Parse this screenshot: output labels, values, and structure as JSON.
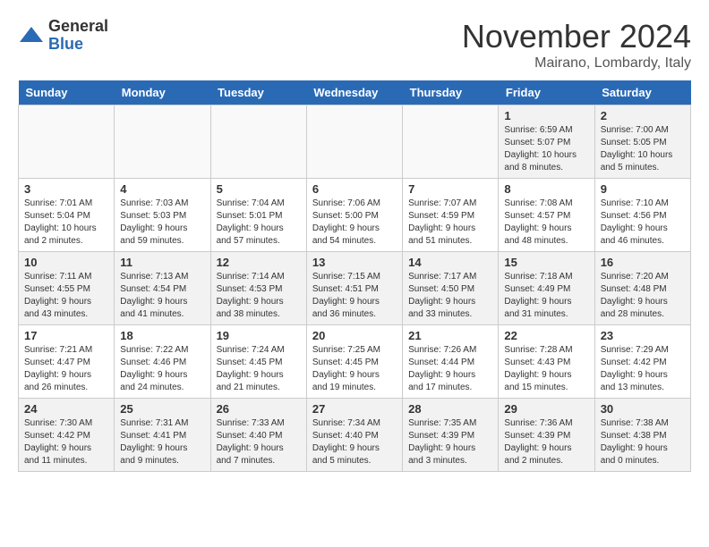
{
  "logo": {
    "general": "General",
    "blue": "Blue"
  },
  "title": "November 2024",
  "location": "Mairano, Lombardy, Italy",
  "headers": [
    "Sunday",
    "Monday",
    "Tuesday",
    "Wednesday",
    "Thursday",
    "Friday",
    "Saturday"
  ],
  "weeks": [
    [
      {
        "day": "",
        "info": ""
      },
      {
        "day": "",
        "info": ""
      },
      {
        "day": "",
        "info": ""
      },
      {
        "day": "",
        "info": ""
      },
      {
        "day": "",
        "info": ""
      },
      {
        "day": "1",
        "info": "Sunrise: 6:59 AM\nSunset: 5:07 PM\nDaylight: 10 hours and 8 minutes."
      },
      {
        "day": "2",
        "info": "Sunrise: 7:00 AM\nSunset: 5:05 PM\nDaylight: 10 hours and 5 minutes."
      }
    ],
    [
      {
        "day": "3",
        "info": "Sunrise: 7:01 AM\nSunset: 5:04 PM\nDaylight: 10 hours and 2 minutes."
      },
      {
        "day": "4",
        "info": "Sunrise: 7:03 AM\nSunset: 5:03 PM\nDaylight: 9 hours and 59 minutes."
      },
      {
        "day": "5",
        "info": "Sunrise: 7:04 AM\nSunset: 5:01 PM\nDaylight: 9 hours and 57 minutes."
      },
      {
        "day": "6",
        "info": "Sunrise: 7:06 AM\nSunset: 5:00 PM\nDaylight: 9 hours and 54 minutes."
      },
      {
        "day": "7",
        "info": "Sunrise: 7:07 AM\nSunset: 4:59 PM\nDaylight: 9 hours and 51 minutes."
      },
      {
        "day": "8",
        "info": "Sunrise: 7:08 AM\nSunset: 4:57 PM\nDaylight: 9 hours and 48 minutes."
      },
      {
        "day": "9",
        "info": "Sunrise: 7:10 AM\nSunset: 4:56 PM\nDaylight: 9 hours and 46 minutes."
      }
    ],
    [
      {
        "day": "10",
        "info": "Sunrise: 7:11 AM\nSunset: 4:55 PM\nDaylight: 9 hours and 43 minutes."
      },
      {
        "day": "11",
        "info": "Sunrise: 7:13 AM\nSunset: 4:54 PM\nDaylight: 9 hours and 41 minutes."
      },
      {
        "day": "12",
        "info": "Sunrise: 7:14 AM\nSunset: 4:53 PM\nDaylight: 9 hours and 38 minutes."
      },
      {
        "day": "13",
        "info": "Sunrise: 7:15 AM\nSunset: 4:51 PM\nDaylight: 9 hours and 36 minutes."
      },
      {
        "day": "14",
        "info": "Sunrise: 7:17 AM\nSunset: 4:50 PM\nDaylight: 9 hours and 33 minutes."
      },
      {
        "day": "15",
        "info": "Sunrise: 7:18 AM\nSunset: 4:49 PM\nDaylight: 9 hours and 31 minutes."
      },
      {
        "day": "16",
        "info": "Sunrise: 7:20 AM\nSunset: 4:48 PM\nDaylight: 9 hours and 28 minutes."
      }
    ],
    [
      {
        "day": "17",
        "info": "Sunrise: 7:21 AM\nSunset: 4:47 PM\nDaylight: 9 hours and 26 minutes."
      },
      {
        "day": "18",
        "info": "Sunrise: 7:22 AM\nSunset: 4:46 PM\nDaylight: 9 hours and 24 minutes."
      },
      {
        "day": "19",
        "info": "Sunrise: 7:24 AM\nSunset: 4:45 PM\nDaylight: 9 hours and 21 minutes."
      },
      {
        "day": "20",
        "info": "Sunrise: 7:25 AM\nSunset: 4:45 PM\nDaylight: 9 hours and 19 minutes."
      },
      {
        "day": "21",
        "info": "Sunrise: 7:26 AM\nSunset: 4:44 PM\nDaylight: 9 hours and 17 minutes."
      },
      {
        "day": "22",
        "info": "Sunrise: 7:28 AM\nSunset: 4:43 PM\nDaylight: 9 hours and 15 minutes."
      },
      {
        "day": "23",
        "info": "Sunrise: 7:29 AM\nSunset: 4:42 PM\nDaylight: 9 hours and 13 minutes."
      }
    ],
    [
      {
        "day": "24",
        "info": "Sunrise: 7:30 AM\nSunset: 4:42 PM\nDaylight: 9 hours and 11 minutes."
      },
      {
        "day": "25",
        "info": "Sunrise: 7:31 AM\nSunset: 4:41 PM\nDaylight: 9 hours and 9 minutes."
      },
      {
        "day": "26",
        "info": "Sunrise: 7:33 AM\nSunset: 4:40 PM\nDaylight: 9 hours and 7 minutes."
      },
      {
        "day": "27",
        "info": "Sunrise: 7:34 AM\nSunset: 4:40 PM\nDaylight: 9 hours and 5 minutes."
      },
      {
        "day": "28",
        "info": "Sunrise: 7:35 AM\nSunset: 4:39 PM\nDaylight: 9 hours and 3 minutes."
      },
      {
        "day": "29",
        "info": "Sunrise: 7:36 AM\nSunset: 4:39 PM\nDaylight: 9 hours and 2 minutes."
      },
      {
        "day": "30",
        "info": "Sunrise: 7:38 AM\nSunset: 4:38 PM\nDaylight: 9 hours and 0 minutes."
      }
    ]
  ]
}
